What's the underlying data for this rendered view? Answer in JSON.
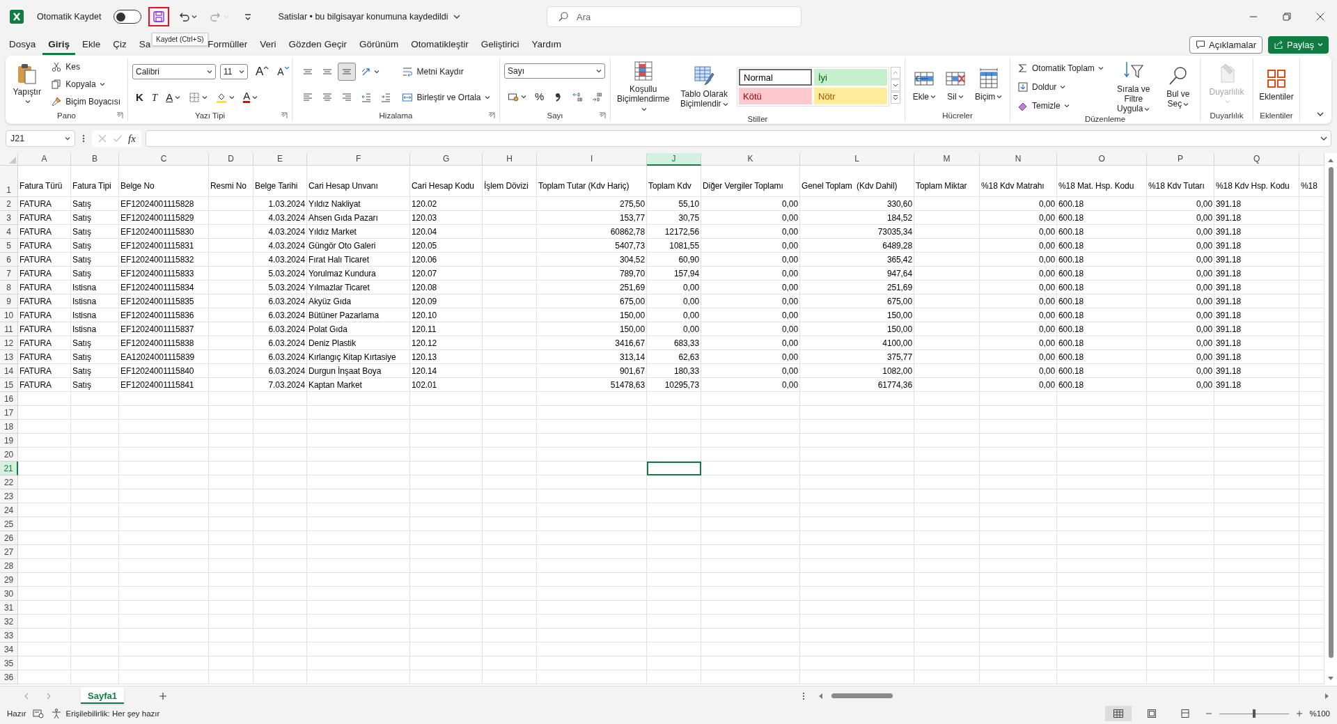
{
  "title_bar": {
    "autosave": {
      "label": "Otomatik Kaydet",
      "on": false
    },
    "quick_access": [
      {
        "kind": "save",
        "highlighted": true,
        "disabled": false,
        "dropdown": false
      },
      {
        "kind": "undo",
        "highlighted": false,
        "disabled": false,
        "dropdown": true
      },
      {
        "kind": "redo",
        "highlighted": false,
        "disabled": true,
        "dropdown": true
      },
      {
        "kind": "customize",
        "highlighted": false,
        "disabled": false,
        "dropdown": false
      }
    ],
    "tooltip": "Kaydet (Ctrl+S)",
    "document_title": "Satislar • bu bilgisayar konumuna kaydedildi",
    "search": {
      "placeholder": "Ara"
    }
  },
  "menu_tabs": [
    {
      "label": "Dosya",
      "selected": false
    },
    {
      "label": "Giriş",
      "selected": true
    },
    {
      "label": "Ekle",
      "selected": false
    },
    {
      "label": "Çiz",
      "selected": false
    },
    {
      "label": "Sa",
      "selected": false
    },
    {
      "label": "Formüller",
      "selected": false
    },
    {
      "label": "Veri",
      "selected": false
    },
    {
      "label": "Gözden Geçir",
      "selected": false
    },
    {
      "label": "Görünüm",
      "selected": false
    },
    {
      "label": "Otomatikleştir",
      "selected": false
    },
    {
      "label": "Geliştirici",
      "selected": false
    },
    {
      "label": "Yardım",
      "selected": false
    }
  ],
  "header_buttons": [
    {
      "kind": "comments",
      "label": "Açıklamalar"
    },
    {
      "kind": "share",
      "label": "Paylaş"
    }
  ],
  "ribbon": {
    "groups": [
      {
        "label": "Pano",
        "launcher": true,
        "sections": [
          [
            [
              {
                "kind": "large",
                "label": "Yapıştır",
                "dropdown": true,
                "disabled": false
              }
            ]
          ],
          [
            [
              {
                "kind": "small",
                "label": "Kes",
                "dropdown": false
              }
            ],
            [
              {
                "kind": "small",
                "label": "Kopyala",
                "dropdown": true
              }
            ],
            [
              {
                "kind": "small",
                "label": "Biçim Boyacısı",
                "dropdown": false
              }
            ]
          ]
        ]
      },
      {
        "label": "Yazı Tipi",
        "launcher": true,
        "sections": [
          [
            [
              {
                "kind": "field",
                "label": "Calibri",
                "dropdown": true
              },
              {
                "kind": "field",
                "label": "11",
                "dropdown": true
              },
              {
                "kind": "glyph",
                "label": "A",
                "dropdown": false,
                "selected": false
              },
              {
                "kind": "glyph",
                "label": "A",
                "dropdown": false,
                "selected": false
              }
            ],
            [
              {
                "kind": "glyph",
                "label": "K",
                "dropdown": false,
                "selected": false
              },
              {
                "kind": "glyph",
                "label": "T",
                "dropdown": false,
                "selected": false
              },
              {
                "kind": "glyph",
                "label": "A",
                "dropdown": true,
                "selected": false
              },
              {
                "kind": "icon",
                "dropdown": true,
                "selected": false
              },
              {
                "kind": "icon",
                "dropdown": true,
                "selected": false
              },
              {
                "kind": "glyph",
                "label": "A",
                "dropdown": true,
                "selected": false
              }
            ]
          ]
        ]
      },
      {
        "label": "Hizalama",
        "launcher": true,
        "sections": [
          [
            [
              {
                "kind": "icon",
                "dropdown": false,
                "selected": false
              },
              {
                "kind": "icon",
                "dropdown": false,
                "selected": false
              },
              {
                "kind": "icon",
                "dropdown": false,
                "selected": true
              },
              {
                "kind": "icon",
                "dropdown": true,
                "selected": false
              }
            ],
            [
              {
                "kind": "icon",
                "dropdown": false,
                "selected": false
              },
              {
                "kind": "icon",
                "dropdown": false,
                "selected": false
              },
              {
                "kind": "icon",
                "dropdown": false,
                "selected": false
              },
              {
                "kind": "icon",
                "dropdown": false,
                "selected": false
              },
              {
                "kind": "icon",
                "dropdown": false,
                "selected": false
              }
            ]
          ],
          [
            [
              {
                "kind": "small",
                "label": "Metni Kaydır",
                "dropdown": false
              }
            ],
            [
              {
                "kind": "small",
                "label": "Birleştir ve Ortala",
                "dropdown": true
              }
            ]
          ]
        ]
      },
      {
        "label": "Sayı",
        "launcher": true,
        "sections": [
          [
            [
              {
                "kind": "field",
                "label": "Sayı",
                "dropdown": true
              }
            ],
            [
              {
                "kind": "icon",
                "dropdown": true,
                "selected": false
              },
              {
                "kind": "glyph",
                "label": "%",
                "dropdown": false,
                "selected": false
              },
              {
                "kind": "icon",
                "dropdown": false,
                "selected": false
              },
              {
                "kind": "icon",
                "dropdown": false,
                "selected": false
              },
              {
                "kind": "icon",
                "dropdown": false,
                "selected": false
              }
            ]
          ]
        ]
      },
      {
        "label": "Stiller",
        "launcher": false,
        "sections": [
          [
            [
              {
                "kind": "large",
                "label": "Koşullu Biçimlendirme",
                "dropdown": true,
                "disabled": false
              }
            ]
          ],
          [
            [
              {
                "kind": "large",
                "label": "Tablo Olarak Biçimlendir",
                "dropdown": true,
                "disabled": false
              }
            ]
          ],
          [
            [
              {
                "kind": "gallery",
                "cells": [
                  {
                    "label": "Normal",
                    "selected": true,
                    "color": "#ffffff"
                  },
                  {
                    "label": "İyi",
                    "selected": false,
                    "color": "#c6efce"
                  },
                  {
                    "label": "Kötü",
                    "selected": false,
                    "color": "#ffc7ce"
                  },
                  {
                    "label": "Nötr",
                    "selected": false,
                    "color": "#ffeb9c"
                  }
                ]
              }
            ]
          ]
        ]
      },
      {
        "label": "Hücreler",
        "launcher": false,
        "sections": [
          [
            [
              {
                "kind": "large",
                "label": "Ekle",
                "dropdown": true,
                "disabled": false
              }
            ]
          ],
          [
            [
              {
                "kind": "large",
                "label": "Sil",
                "dropdown": true,
                "disabled": false
              }
            ]
          ],
          [
            [
              {
                "kind": "large",
                "label": "Biçim",
                "dropdown": true,
                "disabled": false
              }
            ]
          ]
        ]
      },
      {
        "label": "Düzenleme",
        "launcher": false,
        "sections": [
          [
            [
              {
                "kind": "small",
                "label": "Otomatik Toplam",
                "dropdown": true
              }
            ],
            [
              {
                "kind": "small",
                "label": "Doldur",
                "dropdown": true
              }
            ],
            [
              {
                "kind": "small",
                "label": "Temizle",
                "dropdown": true
              }
            ]
          ],
          [
            [
              {
                "kind": "large",
                "label": "Sırala ve Filtre Uygula",
                "dropdown": true,
                "disabled": false
              }
            ]
          ],
          [
            [
              {
                "kind": "large",
                "label": "Bul ve Seç",
                "dropdown": true,
                "disabled": false
              }
            ]
          ]
        ]
      },
      {
        "label": "Duyarlılık",
        "launcher": false,
        "sections": [
          [
            [
              {
                "kind": "large",
                "label": "Duyarlılık",
                "dropdown": true,
                "disabled": true
              }
            ]
          ]
        ]
      },
      {
        "label": "Eklentiler",
        "launcher": false,
        "sections": [
          [
            [
              {
                "kind": "large",
                "label": "Eklentiler",
                "dropdown": false,
                "disabled": false
              }
            ]
          ]
        ]
      }
    ]
  },
  "formula_bar": {
    "name_box": "J21",
    "fx": "fx"
  },
  "sheet": {
    "columns": [
      {
        "letter": "A",
        "selected": false,
        "kind": "text"
      },
      {
        "letter": "B",
        "selected": false,
        "kind": "text"
      },
      {
        "letter": "C",
        "selected": false,
        "kind": "text"
      },
      {
        "letter": "D",
        "selected": false,
        "kind": "text"
      },
      {
        "letter": "E",
        "selected": false,
        "kind": "number"
      },
      {
        "letter": "F",
        "selected": false,
        "kind": "text"
      },
      {
        "letter": "G",
        "selected": false,
        "kind": "text"
      },
      {
        "letter": "H",
        "selected": false,
        "kind": "text"
      },
      {
        "letter": "I",
        "selected": false,
        "kind": "number"
      },
      {
        "letter": "J",
        "selected": true,
        "kind": "number"
      },
      {
        "letter": "K",
        "selected": false,
        "kind": "number"
      },
      {
        "letter": "L",
        "selected": false,
        "kind": "number"
      },
      {
        "letter": "M",
        "selected": false,
        "kind": "number"
      },
      {
        "letter": "N",
        "selected": false,
        "kind": "number"
      },
      {
        "letter": "O",
        "selected": false,
        "kind": "text"
      },
      {
        "letter": "P",
        "selected": false,
        "kind": "number"
      },
      {
        "letter": "Q",
        "selected": false,
        "kind": "text"
      },
      {
        "selected": false,
        "kind": "text"
      }
    ],
    "rows": [
      {
        "number": "1",
        "selected": false,
        "cells": [
          "Fatura Türü",
          "Fatura Tipi",
          "Belge No",
          "Resmi No",
          "Belge Tarihi",
          "Cari Hesap Unvanı",
          "Cari Hesap Kodu",
          "İşlem Dövizi",
          "Toplam Tutar (Kdv Hariç)",
          "Toplam Kdv",
          "Diğer Vergiler Toplamı",
          "Genel Toplam  (Kdv Dahil)",
          "Toplam Miktar",
          "%18 Kdv Matrahı",
          "%18 Mat. Hsp. Kodu",
          "%18 Kdv Tutarı",
          "%18 Kdv Hsp. Kodu",
          "%18"
        ]
      },
      {
        "number": "2",
        "selected": false,
        "cells": [
          "FATURA",
          "Satış",
          "EF12024001115828",
          null,
          "1.03.2024",
          "Yıldız Nakliyat",
          "120.02",
          null,
          "275,50",
          "55,10",
          "0,00",
          "330,60",
          null,
          "0,00",
          "600.18",
          "0,00",
          "391.18"
        ]
      },
      {
        "number": "3",
        "selected": false,
        "cells": [
          "FATURA",
          "Satış",
          "EF12024001115829",
          null,
          "4.03.2024",
          "Ahsen Gıda Pazarı",
          "120.03",
          null,
          "153,77",
          "30,75",
          "0,00",
          "184,52",
          null,
          "0,00",
          "600.18",
          "0,00",
          "391.18"
        ]
      },
      {
        "number": "4",
        "selected": false,
        "cells": [
          "FATURA",
          "Satış",
          "EF12024001115830",
          null,
          "4.03.2024",
          "Yıldız Market",
          "120.04",
          null,
          "60862,78",
          "12172,56",
          "0,00",
          "73035,34",
          null,
          "0,00",
          "600.18",
          "0,00",
          "391.18"
        ]
      },
      {
        "number": "5",
        "selected": false,
        "cells": [
          "FATURA",
          "Satış",
          "EF12024001115831",
          null,
          "4.03.2024",
          "Güngör Oto Galeri",
          "120.05",
          null,
          "5407,73",
          "1081,55",
          "0,00",
          "6489,28",
          null,
          "0,00",
          "600.18",
          "0,00",
          "391.18"
        ]
      },
      {
        "number": "6",
        "selected": false,
        "cells": [
          "FATURA",
          "Satış",
          "EF12024001115832",
          null,
          "4.03.2024",
          "Fırat Halı Ticaret",
          "120.06",
          null,
          "304,52",
          "60,90",
          "0,00",
          "365,42",
          null,
          "0,00",
          "600.18",
          "0,00",
          "391.18"
        ]
      },
      {
        "number": "7",
        "selected": false,
        "cells": [
          "FATURA",
          "Satış",
          "EF12024001115833",
          null,
          "5.03.2024",
          "Yorulmaz Kundura",
          "120.07",
          null,
          "789,70",
          "157,94",
          "0,00",
          "947,64",
          null,
          "0,00",
          "600.18",
          "0,00",
          "391.18"
        ]
      },
      {
        "number": "8",
        "selected": false,
        "cells": [
          "FATURA",
          "Istisna",
          "EF12024001115834",
          null,
          "5.03.2024",
          "Yılmazlar Ticaret",
          "120.08",
          null,
          "251,69",
          "0,00",
          "0,00",
          "251,69",
          null,
          "0,00",
          "600.18",
          "0,00",
          "391.18"
        ]
      },
      {
        "number": "9",
        "selected": false,
        "cells": [
          "FATURA",
          "Istisna",
          "EF12024001115835",
          null,
          "6.03.2024",
          "Akyüz Gıda",
          "120.09",
          null,
          "675,00",
          "0,00",
          "0,00",
          "675,00",
          null,
          "0,00",
          "600.18",
          "0,00",
          "391.18"
        ]
      },
      {
        "number": "10",
        "selected": false,
        "cells": [
          "FATURA",
          "Istisna",
          "EF12024001115836",
          null,
          "6.03.2024",
          "Bütüner Pazarlama",
          "120.10",
          null,
          "150,00",
          "0,00",
          "0,00",
          "150,00",
          null,
          "0,00",
          "600.18",
          "0,00",
          "391.18"
        ]
      },
      {
        "number": "11",
        "selected": false,
        "cells": [
          "FATURA",
          "Istisna",
          "EF12024001115837",
          null,
          "6.03.2024",
          "Polat Gıda",
          "120.11",
          null,
          "150,00",
          "0,00",
          "0,00",
          "150,00",
          null,
          "0,00",
          "600.18",
          "0,00",
          "391.18"
        ]
      },
      {
        "number": "12",
        "selected": false,
        "cells": [
          "FATURA",
          "Satış",
          "EF12024001115838",
          null,
          "6.03.2024",
          "Deniz Plastik",
          "120.12",
          null,
          "3416,67",
          "683,33",
          "0,00",
          "4100,00",
          null,
          "0,00",
          "600.18",
          "0,00",
          "391.18"
        ]
      },
      {
        "number": "13",
        "selected": false,
        "cells": [
          "FATURA",
          "Satış",
          "EA12024001115839",
          null,
          "6.03.2024",
          "Kırlangıç Kitap Kırtasiye",
          "120.13",
          null,
          "313,14",
          "62,63",
          "0,00",
          "375,77",
          null,
          "0,00",
          "600.18",
          "0,00",
          "391.18"
        ]
      },
      {
        "number": "14",
        "selected": false,
        "cells": [
          "FATURA",
          "Satış",
          "EF12024001115840",
          null,
          "6.03.2024",
          "Durgun İnşaat Boya",
          "120.14",
          null,
          "901,67",
          "180,33",
          "0,00",
          "1082,00",
          null,
          "0,00",
          "600.18",
          "0,00",
          "391.18"
        ]
      },
      {
        "number": "15",
        "selected": false,
        "cells": [
          "FATURA",
          "Satış",
          "EF12024001115841",
          null,
          "7.03.2024",
          "Kaptan Market",
          "102.01",
          null,
          "51478,63",
          "10295,73",
          "0,00",
          "61774,36",
          null,
          "0,00",
          "600.18",
          "0,00",
          "391.18"
        ]
      },
      {
        "number": "16",
        "selected": false
      },
      {
        "number": "17",
        "selected": false
      },
      {
        "number": "18",
        "selected": false
      },
      {
        "number": "19",
        "selected": false
      },
      {
        "number": "20",
        "selected": false
      },
      {
        "number": "21",
        "selected": true
      },
      {
        "number": "22",
        "selected": false
      },
      {
        "number": "23",
        "selected": false
      },
      {
        "number": "24",
        "selected": false
      },
      {
        "number": "25",
        "selected": false
      },
      {
        "number": "26",
        "selected": false
      },
      {
        "number": "27",
        "selected": false
      },
      {
        "number": "28",
        "selected": false
      },
      {
        "number": "29",
        "selected": false
      },
      {
        "number": "30",
        "selected": false
      },
      {
        "number": "31",
        "selected": false
      },
      {
        "number": "32",
        "selected": false
      },
      {
        "number": "33",
        "selected": false
      },
      {
        "number": "34",
        "selected": false
      },
      {
        "number": "35",
        "selected": false
      },
      {
        "number": "36",
        "selected": false
      }
    ]
  },
  "sheet_tabs": [
    {
      "label": "Sayfa1",
      "selected": true
    }
  ],
  "status_bar": {
    "mode": "Hazır",
    "accessibility": "Erişilebilirlik: Her şey hazır",
    "views": [
      {
        "kind": "normal",
        "selected": true
      },
      {
        "kind": "page_layout",
        "selected": false
      },
      {
        "kind": "page_break",
        "selected": false
      }
    ],
    "zoom": {
      "level": 0.5,
      "label": "%100"
    }
  }
}
